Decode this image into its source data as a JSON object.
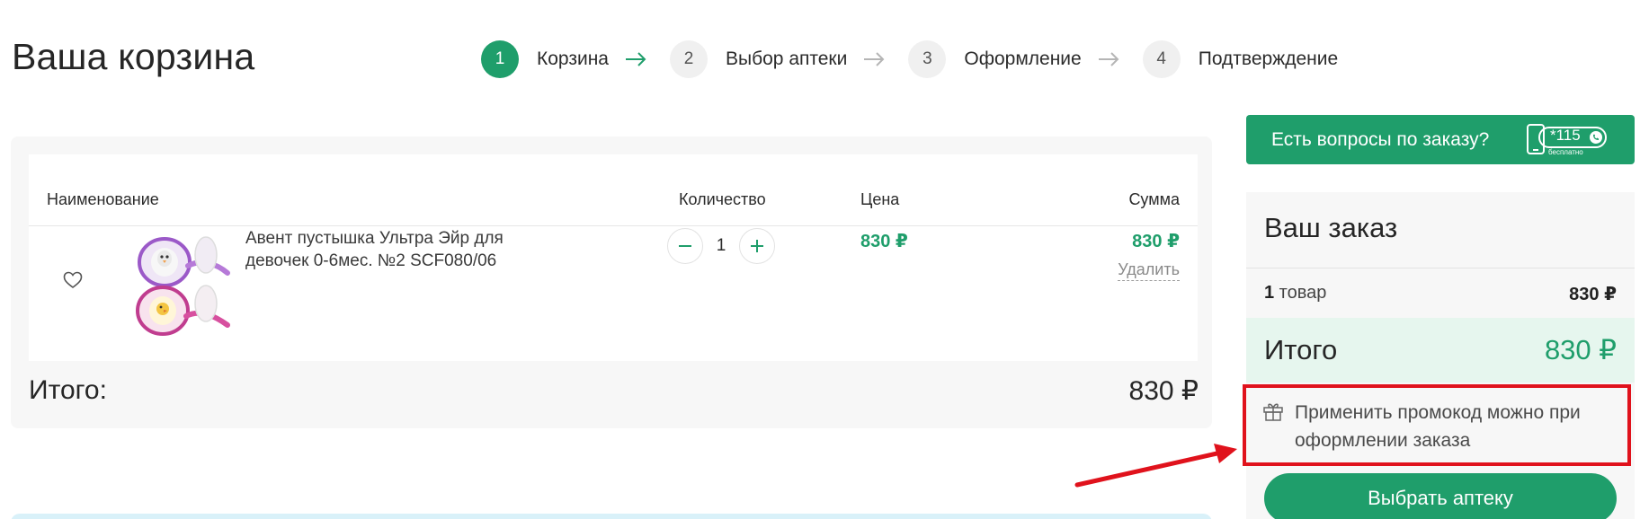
{
  "page": {
    "title": "Ваша корзина"
  },
  "steps": [
    {
      "number": "1",
      "label": "Корзина",
      "active": true
    },
    {
      "number": "2",
      "label": "Выбор аптеки",
      "active": false
    },
    {
      "number": "3",
      "label": "Оформление",
      "active": false
    },
    {
      "number": "4",
      "label": "Подтверждение",
      "active": false
    }
  ],
  "cart": {
    "columns": {
      "name": "Наименование",
      "quantity": "Количество",
      "price": "Цена",
      "sum": "Сумма"
    },
    "items": [
      {
        "name": "Авент пустышка Ультра Эйр для девочек 0-6мес. №2 SCF080/06",
        "quantity": "1",
        "price": "830 ₽",
        "sum": "830 ₽",
        "delete_label": "Удалить"
      }
    ],
    "total_label": "Итого:",
    "total_value": "830 ₽"
  },
  "sidebar": {
    "question_button": "Есть вопросы по заказу?",
    "phone_short": "*115",
    "phone_free": "бесплатно",
    "order": {
      "title": "Ваш заказ",
      "items_count_number": "1",
      "items_count_word": " товар",
      "items_sum": "830 ₽",
      "total_label": "Итого",
      "total_value": "830 ₽",
      "promo_text": "Применить промокод можно при оформлении заказа",
      "choose_button": "Выбрать аптеку"
    }
  },
  "colors": {
    "accent": "#1f9e6b",
    "annotation": "#e0121c",
    "total_band": "#e6f6ee",
    "card_bg": "#f7f7f7"
  }
}
